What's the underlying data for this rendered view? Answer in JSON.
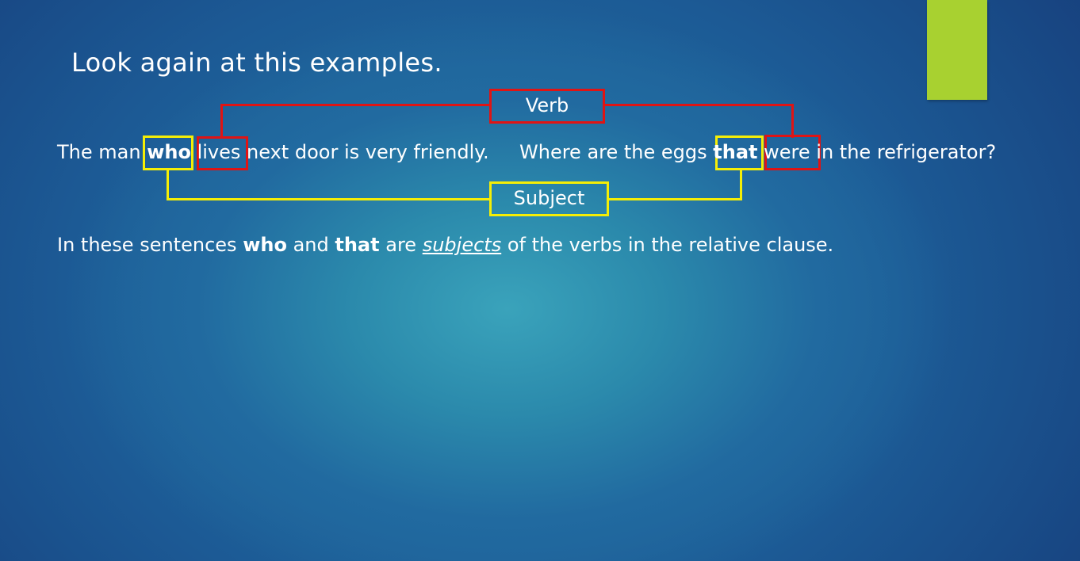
{
  "slide": {
    "title": "Look again at this examples.",
    "accent_color": "#a8d130",
    "labels": {
      "verb": "Verb",
      "subject": "Subject"
    },
    "sentence_1": {
      "before": "The man",
      "relative": "who",
      "verb": "lives",
      "after": "next door is very friendly."
    },
    "sentence_2": {
      "before": "Where are the eggs",
      "relative": "that",
      "verb": "were",
      "after": "in the refrigerator?"
    },
    "explanation": {
      "part1": "In these sentences",
      "who": "who",
      "part2": "and",
      "that": "that",
      "part3": "are",
      "subjects": "subjects",
      "part4": "of the verbs in the relative clause."
    },
    "colors": {
      "verb_highlight": "#e01414",
      "subject_highlight": "#f5ee06"
    }
  }
}
